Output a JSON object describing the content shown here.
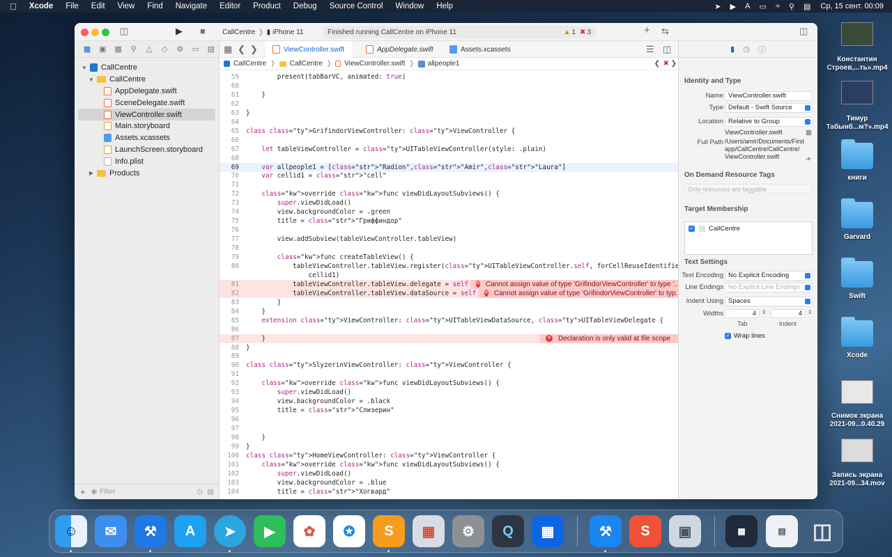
{
  "menubar": {
    "app_name": "Xcode",
    "items": [
      "File",
      "Edit",
      "View",
      "Find",
      "Navigate",
      "Editor",
      "Product",
      "Debug",
      "Source Control",
      "Window",
      "Help"
    ],
    "clock": "Ср, 15 сент.  00:09"
  },
  "toolbar": {
    "scheme": "CallCentre",
    "device": "iPhone 11",
    "status": "Finished running CallCentre on iPhone 11",
    "warnings": "1",
    "errors": "3"
  },
  "tabs": [
    "ViewController.swift",
    "AppDelegate.swift",
    "Assets.xcassets"
  ],
  "breadcrumb": [
    "CallCentre",
    "CallCentre",
    "ViewController.swift",
    "allpeople1"
  ],
  "navigator": {
    "items": [
      "CallCentre",
      "CallCentre",
      "AppDelegate.swift",
      "SceneDelegate.swift",
      "ViewController.swift",
      "Main.storyboard",
      "Assets.xcassets",
      "LaunchScreen.storyboard",
      "Info.plist",
      "Products"
    ],
    "filter_placeholder": "Filter"
  },
  "editor": {
    "lines": [
      {
        "n": "59",
        "t": "        present(tabBarVC, animated: true)"
      },
      {
        "n": "60",
        "t": ""
      },
      {
        "n": "61",
        "t": "    }"
      },
      {
        "n": "62",
        "t": ""
      },
      {
        "n": "63",
        "t": "}"
      },
      {
        "n": "64",
        "t": ""
      },
      {
        "n": "65",
        "t": "class GrifindorViewController: ViewController {"
      },
      {
        "n": "66",
        "t": ""
      },
      {
        "n": "67",
        "t": "    let tableViewController = UITableViewController(style: .plain)"
      },
      {
        "n": "68",
        "t": ""
      },
      {
        "n": "69",
        "t": "    var allpeople1 = [\"Radion\",\"Amir\",\"Laura\"]"
      },
      {
        "n": "70",
        "t": "    var cellid1 = \"cell\""
      },
      {
        "n": "71",
        "t": ""
      },
      {
        "n": "72",
        "t": "    override func viewDidLayoutSubviews() {"
      },
      {
        "n": "73",
        "t": "        super.viewDidLoad()"
      },
      {
        "n": "74",
        "t": "        view.backgroundColor = .green"
      },
      {
        "n": "75",
        "t": "        title = \"Гриффиндор\""
      },
      {
        "n": "76",
        "t": ""
      },
      {
        "n": "77",
        "t": "        view.addSubview(tableViewController.tableView)"
      },
      {
        "n": "78",
        "t": ""
      },
      {
        "n": "79",
        "t": "        func createTableView() {"
      },
      {
        "n": "80",
        "t": "            tableViewController.tableView.register(UITableViewController.self, forCellReuseIdentifier:"
      },
      {
        "n": "",
        "t": "                cellid1)"
      },
      {
        "n": "81",
        "t": "            tableViewController.tableView.delegate = self"
      },
      {
        "n": "82",
        "t": "            tableViewController.tableView.dataSource = self"
      },
      {
        "n": "83",
        "t": "        }"
      },
      {
        "n": "84",
        "t": "    }"
      },
      {
        "n": "85",
        "t": "    extension ViewController: UITableViewDataSource, UITableViewDelegate {"
      },
      {
        "n": "86",
        "t": ""
      },
      {
        "n": "87",
        "t": "    }"
      },
      {
        "n": "88",
        "t": "}"
      },
      {
        "n": "89",
        "t": ""
      },
      {
        "n": "90",
        "t": "class SlyzerinViewController: ViewController {"
      },
      {
        "n": "91",
        "t": ""
      },
      {
        "n": "92",
        "t": "    override func viewDidLayoutSubviews() {"
      },
      {
        "n": "93",
        "t": "        super.viewDidLoad()"
      },
      {
        "n": "94",
        "t": "        view.backgroundColor = .black"
      },
      {
        "n": "95",
        "t": "        title = \"Слизерин\""
      },
      {
        "n": "96",
        "t": ""
      },
      {
        "n": "97",
        "t": ""
      },
      {
        "n": "98",
        "t": "    }"
      },
      {
        "n": "99",
        "t": "}"
      },
      {
        "n": "100",
        "t": "class HomeViewController: ViewController {"
      },
      {
        "n": "101",
        "t": "    override func viewDidLayoutSubviews() {"
      },
      {
        "n": "102",
        "t": "        super.viewDidLoad()"
      },
      {
        "n": "103",
        "t": "        view.backgroundColor = .blue"
      },
      {
        "n": "104",
        "t": "        title = \"Хогвард\""
      }
    ],
    "errors": [
      "Cannot assign value of type 'GrifindorViewController' to type '...",
      "Cannot assign value of type 'GrifindorViewController' to typ...",
      "Declaration is only valid at file scope"
    ]
  },
  "inspector": {
    "identity_title": "Identity and Type",
    "name_label": "Name",
    "name_value": "ViewController.swift",
    "type_label": "Type",
    "type_value": "Default - Swift Source",
    "location_label": "Location",
    "location_value": "Relative to Group",
    "location_file": "ViewController.swift",
    "fullpath_label": "Full Path",
    "fullpath_value": "/Users/amir/Documents/First app/CallCentre/CallCentre/ ViewController.swift",
    "odr_title": "On Demand Resource Tags",
    "odr_placeholder": "Only resources are taggable",
    "target_title": "Target Membership",
    "target_name": "CallCentre",
    "text_title": "Text Settings",
    "encoding_label": "Text Encoding",
    "encoding_value": "No Explicit Encoding",
    "endings_label": "Line Endings",
    "endings_value": "No Explicit Line Endings",
    "indent_label": "Indent Using",
    "indent_value": "Spaces",
    "widths_label": "Widths",
    "tab_value": "4",
    "indent_num": "4",
    "tab_caption": "Tab",
    "indent_caption": "Indent",
    "wrap_label": "Wrap lines"
  },
  "desktop": {
    "items": [
      "Константин Строев,...ть».mp4",
      "Тимур Табынб...м?».mp4",
      "книги",
      "Garvard",
      "Swift",
      "Xcode",
      "Снимок экрана 2021-09...0.40.29",
      "Запись экрана 2021-09...34.mov"
    ]
  },
  "dock": {
    "apps": [
      "finder-icon",
      "mail-icon",
      "xcode-icon",
      "app-store-icon",
      "telegram-icon",
      "facetime-icon",
      "photos-icon",
      "safari-icon",
      "sublime-icon",
      "launchpad-icon",
      "settings-icon",
      "quicktime-icon",
      "trello-icon",
      "xcode-dev-icon",
      "swift-icon",
      "preview-icon",
      "trash-icon"
    ]
  }
}
